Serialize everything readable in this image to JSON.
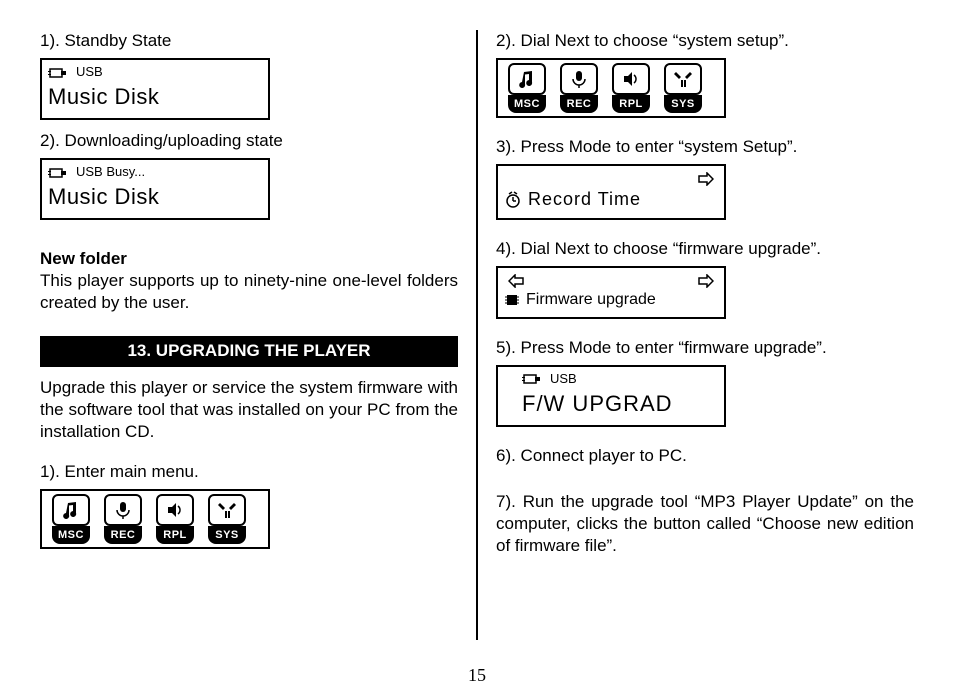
{
  "page_number": "15",
  "left": {
    "step1": "1). Standby State",
    "lcd1_usb": "USB",
    "lcd1_main": "Music Disk",
    "step2": "2). Downloading/uploading state",
    "lcd2_usb": "USB Busy...",
    "lcd2_main": "Music Disk",
    "new_folder_heading": "New folder",
    "new_folder_body": "This player supports up to ninety-nine one-level folders created by the user.",
    "section13": "13. UPGRADING THE PLAYER",
    "upgrade_body": "Upgrade this player or service the system firmware with the software tool that was installed on your PC from the installation CD.",
    "step_enter_main": "1). Enter main menu.",
    "menu": [
      "MSC",
      "REC",
      "RPL",
      "SYS"
    ]
  },
  "right": {
    "step2": "2). Dial Next to choose “system setup”.",
    "menu": [
      "MSC",
      "REC",
      "RPL",
      "SYS"
    ],
    "step3": "3). Press Mode to enter “system Setup”.",
    "lcd3_main": "Record Time",
    "step4": "4). Dial Next to choose “firmware upgrade”.",
    "lcd4_main": "Firmware upgrade",
    "step5": "5). Press Mode to enter “firmware upgrade”.",
    "lcd5_usb": "USB",
    "lcd5_main": "F/W UPGRAD",
    "step6": "6). Connect player to PC.",
    "step7": "7). Run the upgrade tool “MP3 Player Update” on the computer, clicks the button called “Choose new edition of firmware file”."
  }
}
